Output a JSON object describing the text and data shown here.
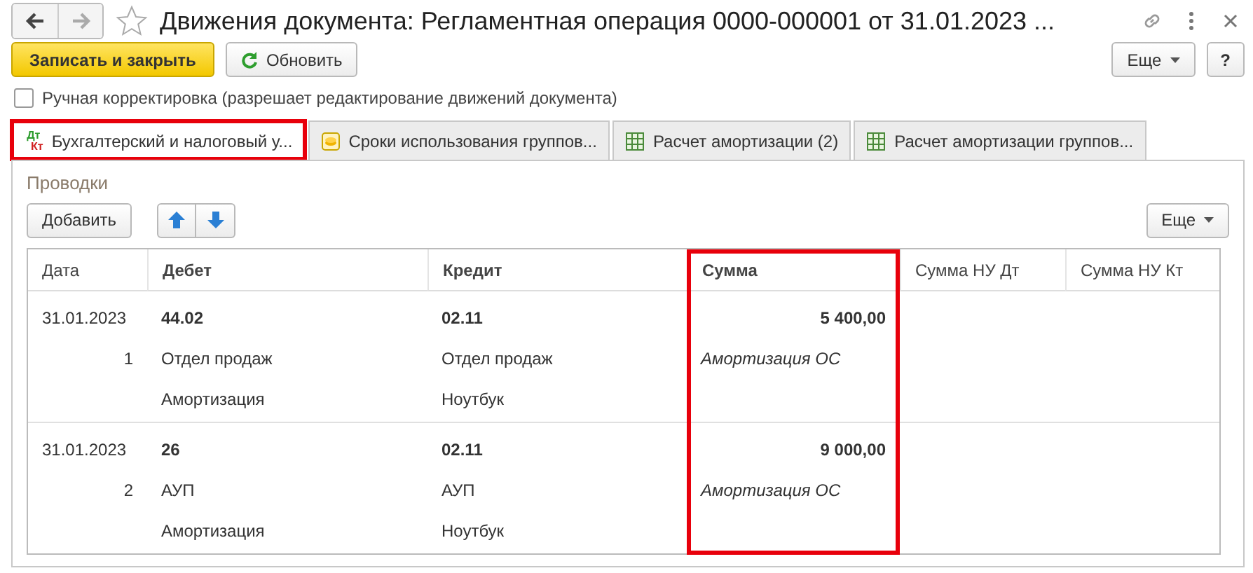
{
  "window": {
    "title": "Движения документа: Регламентная операция 0000-000001 от 31.01.2023 ...",
    "favorite": false
  },
  "toolbar": {
    "primary": "Записать и закрыть",
    "refresh": "Обновить",
    "more": "Еще",
    "help": "?"
  },
  "manual_correction": {
    "label": "Ручная корректировка (разрешает редактирование движений документа)",
    "checked": false
  },
  "tabs": [
    {
      "label": "Бухгалтерский и налоговый у...",
      "kind": "dtkt",
      "selected": true,
      "highlighted": true,
      "icon_top": "Дт",
      "icon_bottom": "Кт"
    },
    {
      "label": "Сроки использования группов...",
      "kind": "coins",
      "selected": false,
      "highlighted": false
    },
    {
      "label": "Расчет амортизации (2)",
      "kind": "table",
      "selected": false,
      "highlighted": false
    },
    {
      "label": "Расчет амортизации группов...",
      "kind": "table",
      "selected": false,
      "highlighted": false
    }
  ],
  "section": {
    "title": "Проводки",
    "add": "Добавить",
    "more": "Еще"
  },
  "table": {
    "columns": [
      {
        "label": "Дата",
        "bold": false,
        "highlighted": false
      },
      {
        "label": "Дебет",
        "bold": true,
        "highlighted": false
      },
      {
        "label": "Кредит",
        "bold": true,
        "highlighted": false
      },
      {
        "label": "Сумма",
        "bold": true,
        "highlighted": true
      },
      {
        "label": "Сумма НУ Дт",
        "bold": false,
        "highlighted": false
      },
      {
        "label": "Сумма НУ Кт",
        "bold": false,
        "highlighted": false
      }
    ],
    "rows": [
      {
        "date": "31.01.2023",
        "number": "1",
        "debit": [
          "44.02",
          "Отдел продаж",
          "Амортизация"
        ],
        "credit": [
          "02.11",
          "Отдел продаж",
          "Ноутбук"
        ],
        "sum": "5 400,00",
        "content": "Амортизация ОС"
      },
      {
        "date": "31.01.2023",
        "number": "2",
        "debit": [
          "26",
          "АУП",
          "Амортизация"
        ],
        "credit": [
          "02.11",
          "АУП",
          "Ноутбук"
        ],
        "sum": "9 000,00",
        "content": "Амортизация ОС"
      }
    ]
  }
}
